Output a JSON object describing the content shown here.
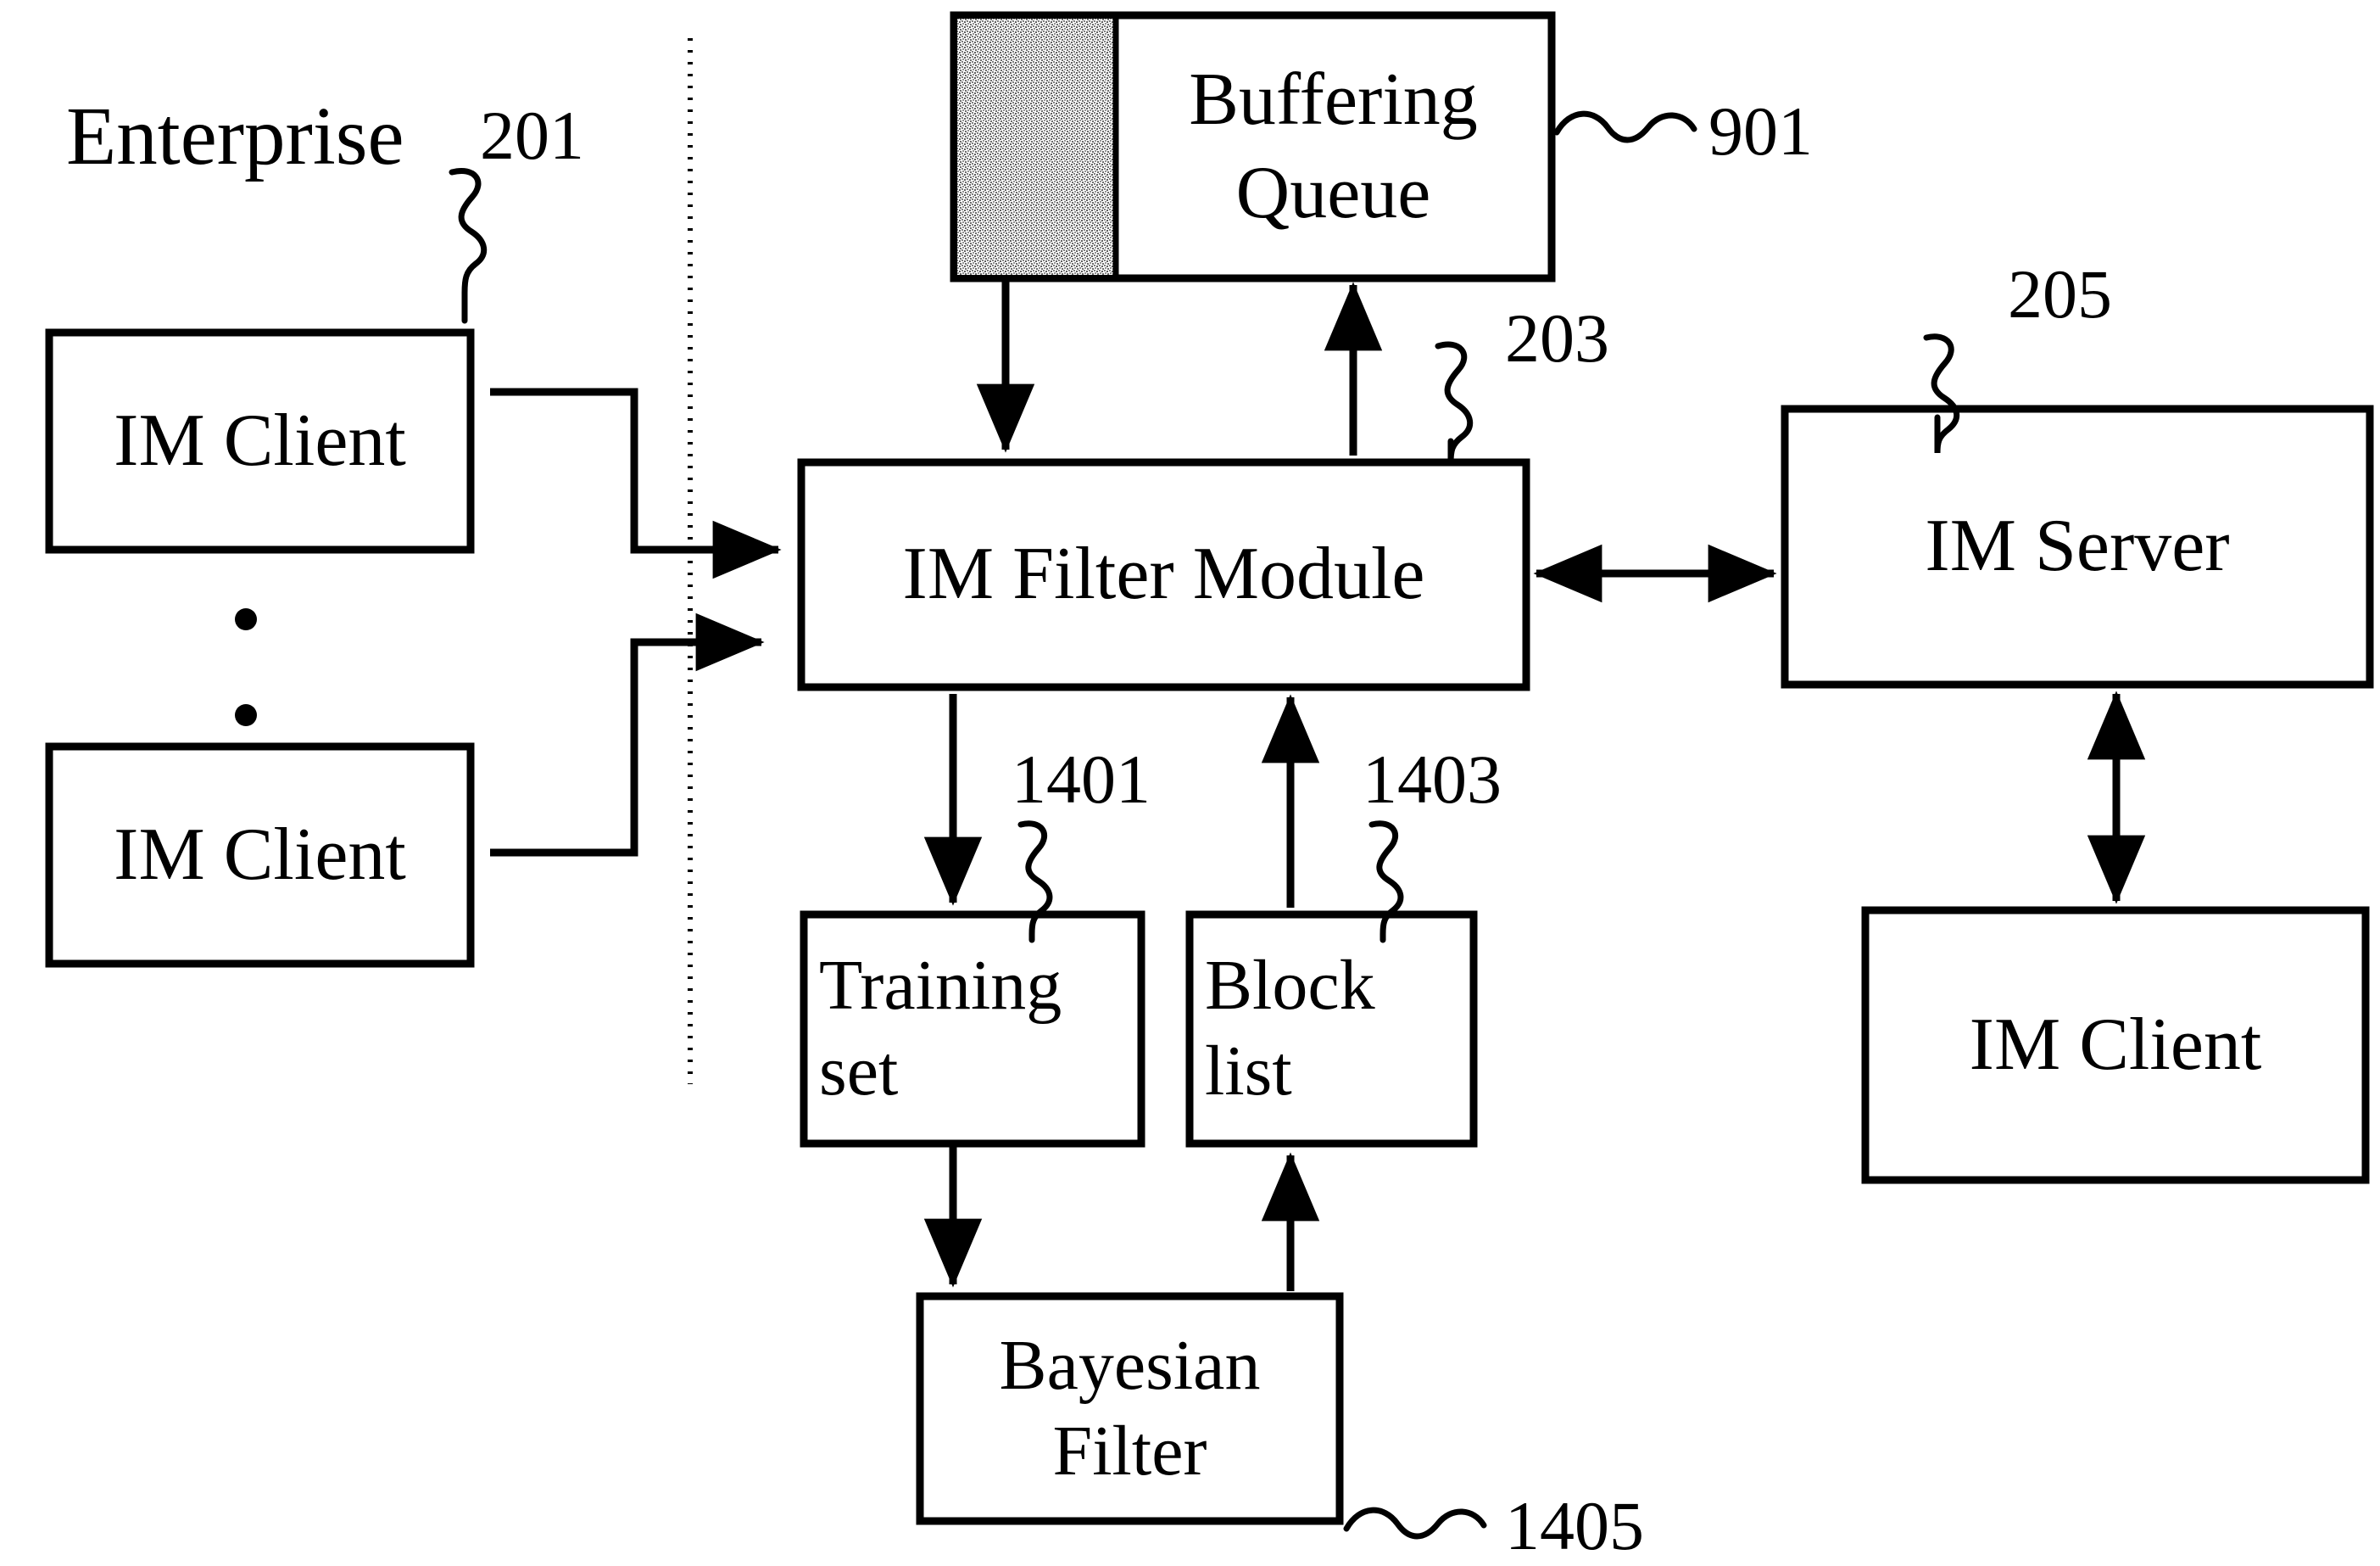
{
  "figure": {
    "type": "block-diagram",
    "background_color": "#ffffff",
    "stroke_color": "#000000",
    "shade_color": "#9a9a9a",
    "enterprise_label": "Enterprise",
    "boundary_line_style": "dotted-vertical"
  },
  "boxes": {
    "im_client_top": {
      "label": "IM Client"
    },
    "im_client_bottom": {
      "label": "IM Client"
    },
    "buffering_queue": {
      "label": "Buffering\nQueue"
    },
    "im_filter_module": {
      "label": "IM Filter Module"
    },
    "im_server": {
      "label": "IM Server"
    },
    "im_client_remote": {
      "label": "IM Client"
    },
    "training_set": {
      "label": "Training\nset"
    },
    "block_list": {
      "label": "Block\nlist"
    },
    "bayesian_filter": {
      "label": "Bayesian\nFilter"
    }
  },
  "reference_numerals": {
    "enterprise": "201",
    "buffering_queue": "901",
    "im_filter_module": "203",
    "im_server": "205",
    "training_set": "1401",
    "block_list": "1403",
    "bayesian_filter": "1405"
  },
  "ellipsis": {
    "symbol": "•"
  }
}
